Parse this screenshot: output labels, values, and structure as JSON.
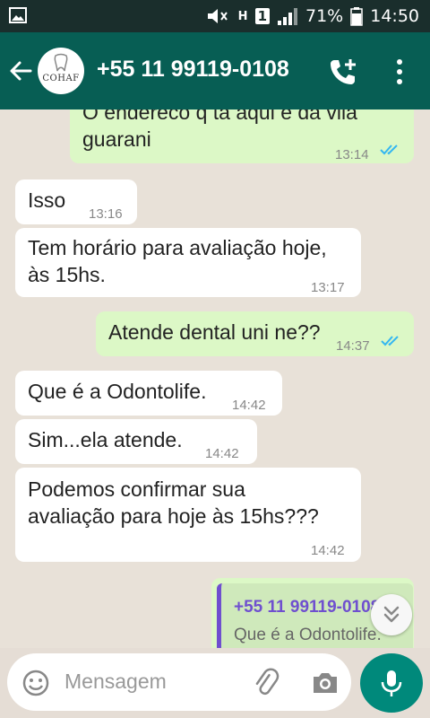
{
  "status": {
    "battery": "71%",
    "time": "14:50",
    "net_h": "H",
    "sim": "1"
  },
  "header": {
    "contact_name": "+55 11 99119-0108",
    "avatar_text": "COHAF"
  },
  "messages": [
    {
      "dir": "out",
      "lines": [
        "O endereco q ta aqui e da vila",
        "guarani"
      ],
      "time": "13:14",
      "read": true
    },
    {
      "dir": "in",
      "lines": [
        "Isso"
      ],
      "time": "13:16"
    },
    {
      "dir": "in",
      "lines": [
        "Tem horário para avaliação hoje,",
        "às 15hs."
      ],
      "time": "13:17"
    },
    {
      "dir": "out",
      "lines": [
        "Atende dental uni ne??"
      ],
      "time": "14:37",
      "read": true
    },
    {
      "dir": "in",
      "lines": [
        "Que é a Odontolife."
      ],
      "time": "14:42"
    },
    {
      "dir": "in",
      "lines": [
        "Sim...ela atende."
      ],
      "time": "14:42"
    },
    {
      "dir": "in",
      "lines": [
        "Podemos confirmar sua",
        "avaliação para hoje às 15hs???"
      ],
      "time": "14:42"
    },
    {
      "dir": "out",
      "reply_to": {
        "author": "+55 11 99119-0108",
        "text": "Que é a Odontolife."
      }
    }
  ],
  "composer": {
    "placeholder": "Mensagem"
  },
  "colors": {
    "appbar": "#075e54",
    "outgoing": "#dcf8c6",
    "incoming": "#ffffff",
    "read_ticks": "#34b7f1",
    "mic": "#00897b"
  },
  "icons": [
    "gallery-icon",
    "mute-icon",
    "signal-icon",
    "battery-icon",
    "back-arrow-icon",
    "add-call-icon",
    "more-vert-icon",
    "emoji-icon",
    "attach-icon",
    "camera-icon",
    "mic-icon",
    "scroll-down-icon"
  ]
}
